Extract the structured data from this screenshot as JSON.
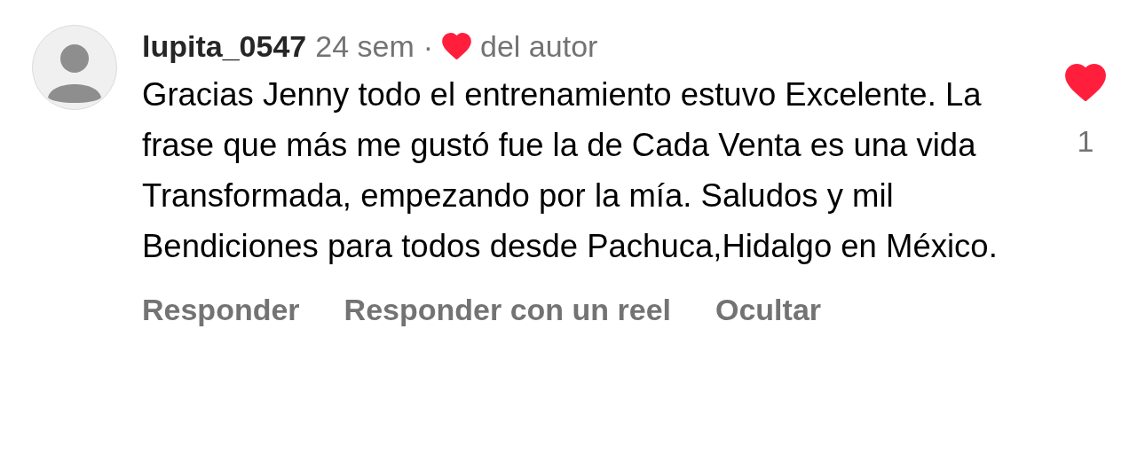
{
  "comment": {
    "username": "lupita_0547",
    "time": "24 sem",
    "separator": "·",
    "author_liked": true,
    "author_label": "del autor",
    "text": "Gracias Jenny todo el entrenamiento estuvo Excelente. La frase que más me gustó fue la de Cada Venta es una vida Transformada, empezando por la mía. Saludos y mil Bendiciones para todos desde Pachuca,Hidalgo en México.",
    "liked": true,
    "like_count": "1",
    "actions": [
      "Responder",
      "Responder con un reel",
      "Ocultar"
    ]
  }
}
